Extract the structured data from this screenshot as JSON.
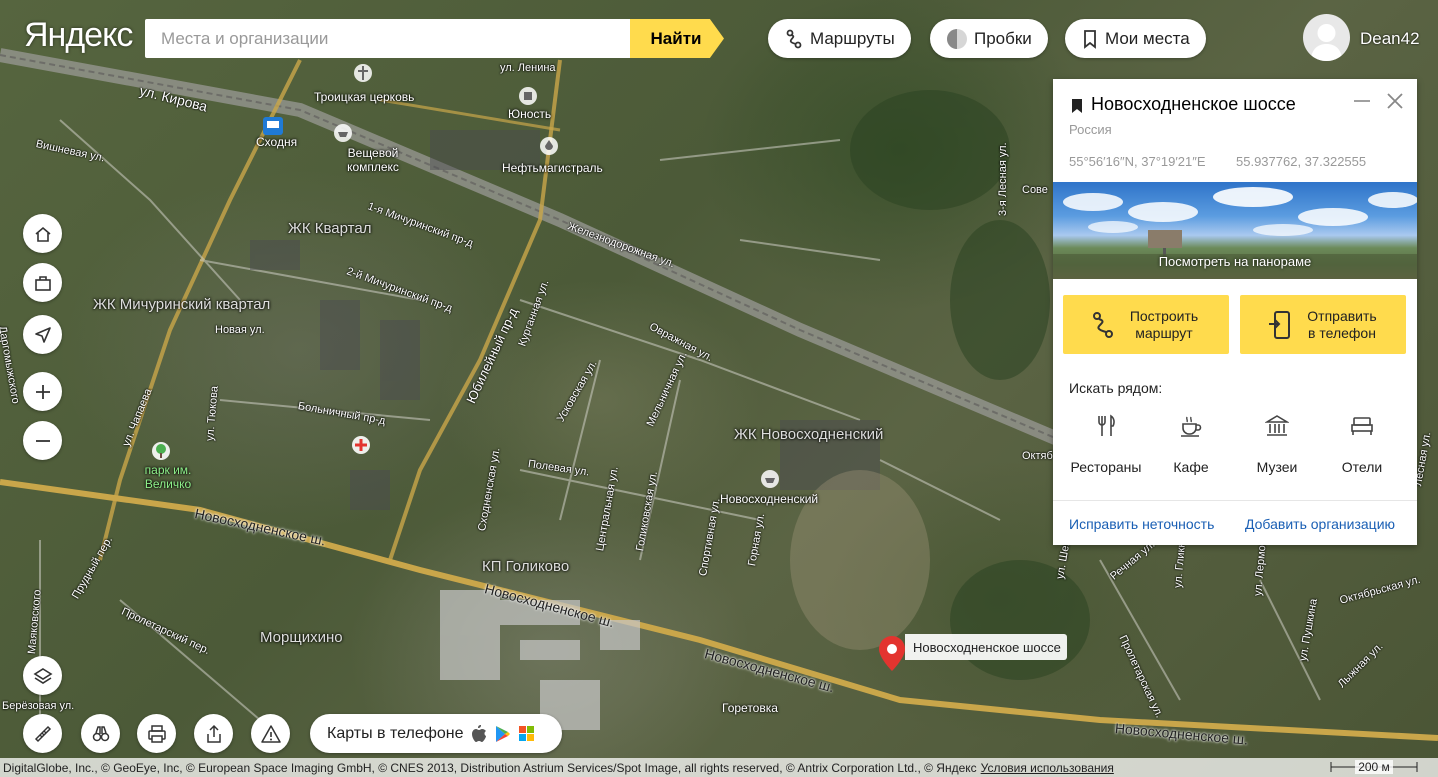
{
  "header": {
    "logo": "Яндекс",
    "search_placeholder": "Места и организации",
    "search_button": "Найти",
    "routes_label": "Маршруты",
    "traffic_label": "Пробки",
    "my_places_label": "Мои места",
    "username": "Dean42"
  },
  "map_labels": {
    "places": [
      "Троицкая церковь",
      "Юность",
      "Сходня",
      "Вещевой комплекс",
      "Нефтьмагистраль",
      "ЖК Квартал",
      "ЖК Мичуринский квартал",
      "парк им. Величко",
      "ЖК Новосходненский",
      "Новосходненский",
      "КП Голиково",
      "Морщихино",
      "Горетовка"
    ],
    "streets": [
      "ул. Кирова",
      "ул. Ленина",
      "Вишневая ул.",
      "1-я Мичуринский пр-д",
      "2-й Мичуринский пр-д",
      "Новая ул.",
      "ул. Чапаева",
      "ул. Тюкова",
      "Больничный пр-д",
      "Юбилейный пр-д",
      "Железнодорожная ул.",
      "Курганная ул.",
      "Овражная ул.",
      "Мельничная ул.",
      "Усковская ул.",
      "Полевая ул.",
      "Сходненская ул.",
      "Центральная ул.",
      "Голиковская ул.",
      "Спортивная ул.",
      "Горная ул.",
      "Прудный пер.",
      "Пролетарский пер.",
      "Маяковского",
      "Берёзовая ул.",
      "Речная ул.",
      "Пролетарская ул.",
      "ул. Гликни",
      "ул. Лермонтова",
      "Октябрьская ул.",
      "ул. Пушкина",
      "Лыжная ул.",
      "ул. Шевченко",
      "3-я Лесная ул.",
      "Сове",
      "Октяб",
      "Лесная ул.",
      "Даргомыжского"
    ],
    "roads": [
      "Новосходненское ш.",
      "Новосходненское ш.",
      "Новосходненское ш.",
      "Новосходненское ш."
    ]
  },
  "marker": {
    "label": "Новосходненское шоссе"
  },
  "card": {
    "title": "Новосходненское шоссе",
    "country": "Россия",
    "coords_dms": "55°56′16″N, 37°19′21″E",
    "coords_decimal": "55.937762, 37.322555",
    "panorama_label": "Посмотреть на панораме",
    "route_button": "Построить маршрут",
    "phone_button": "Отправить в телефон",
    "search_nearby": "Искать рядом:",
    "nearby": [
      "Рестораны",
      "Кафе",
      "Музеи",
      "Отели"
    ],
    "fix_link": "Исправить неточность",
    "add_org_link": "Добавить организацию"
  },
  "bottom": {
    "phone_maps": "Карты в телефоне",
    "copyright": "DigitalGlobe, Inc., © GeoEye, Inc, © European Space Imaging GmbH, © CNES 2013, Distribution Astrium Services/Spot Image, all rights reserved, © Antrix Corporation Ltd., © Яндекс",
    "terms": "Условия использования",
    "scale": "200 м"
  },
  "colors": {
    "accent": "#ffdb4d",
    "link": "#1a5fb4",
    "marker": "#e3342f"
  }
}
